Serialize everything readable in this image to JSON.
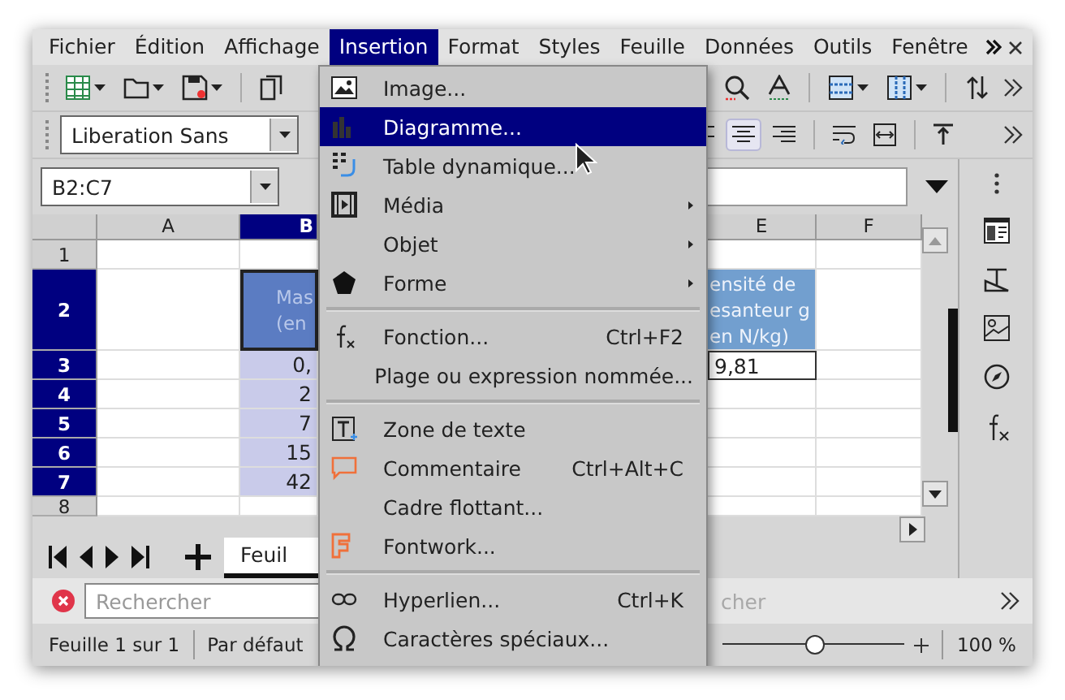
{
  "menubar": {
    "items": [
      {
        "label": "Fichier",
        "selected": false
      },
      {
        "label": "Édition",
        "selected": false
      },
      {
        "label": "Affichage",
        "selected": false
      },
      {
        "label": "Insertion",
        "selected": true
      },
      {
        "label": "Format",
        "selected": false
      },
      {
        "label": "Styles",
        "selected": false
      },
      {
        "label": "Feuille",
        "selected": false
      },
      {
        "label": "Données",
        "selected": false
      },
      {
        "label": "Outils",
        "selected": false
      },
      {
        "label": "Fenêtre",
        "selected": false
      }
    ]
  },
  "font_toolbar": {
    "font_name": "Liberation Sans"
  },
  "formula_bar": {
    "name_box": "B2:C7"
  },
  "grid": {
    "columns": [
      {
        "label": "A",
        "selected": false
      },
      {
        "label": "B",
        "selected": true
      },
      {
        "label": "E",
        "selected": false
      },
      {
        "label": "F",
        "selected": false
      }
    ],
    "rows": [
      {
        "header": "1",
        "selected": false,
        "kind": "data"
      },
      {
        "header": "2",
        "selected": true,
        "kind": "heading",
        "column_b": "Mas\n(en",
        "column_e": "ensité de\nesanteur g\nen N/kg)"
      },
      {
        "header": "3",
        "selected": true,
        "kind": "data",
        "column_b": "0,",
        "column_e": "9,81"
      },
      {
        "header": "4",
        "selected": true,
        "kind": "data",
        "column_b": "2"
      },
      {
        "header": "5",
        "selected": true,
        "kind": "data",
        "column_b": "7"
      },
      {
        "header": "6",
        "selected": true,
        "kind": "data",
        "column_b": "15"
      },
      {
        "header": "7",
        "selected": true,
        "kind": "data",
        "column_b": "42"
      },
      {
        "header": "8",
        "selected": false,
        "kind": "data"
      }
    ]
  },
  "sheet_tabs": [
    {
      "label": "Feuil",
      "selected": true
    }
  ],
  "find_bar": {
    "placeholder": "Rechercher",
    "search_button": {
      "label": "cher",
      "disabled": true
    }
  },
  "status_bar": {
    "sheet_info": "Feuille 1 sur 1",
    "page_style": "Par défaut",
    "zoom": {
      "level": 0.5,
      "reading": "100 %"
    }
  },
  "insert_menu": {
    "items": [
      {
        "kind": "image",
        "label": "Image...",
        "selected": false
      },
      {
        "kind": "chart",
        "label": "Diagramme...",
        "selected": true
      },
      {
        "kind": "pivot",
        "label": "Table dynamique...",
        "selected": false
      },
      {
        "kind": "media",
        "label": "Média",
        "selected": false,
        "submenu": true
      },
      {
        "kind": "object",
        "label": "Objet",
        "selected": false,
        "submenu": true
      },
      {
        "kind": "shape",
        "label": "Forme",
        "selected": false,
        "submenu": true
      },
      {
        "kind": "separator"
      },
      {
        "kind": "function",
        "label": "Fonction...",
        "shortcut": "Ctrl+F2",
        "selected": false
      },
      {
        "kind": "named-range",
        "label": "Plage ou expression nommée...",
        "selected": false
      },
      {
        "kind": "separator"
      },
      {
        "kind": "text-box",
        "label": "Zone de texte",
        "selected": false
      },
      {
        "kind": "comment",
        "label": "Commentaire",
        "shortcut": "Ctrl+Alt+C",
        "selected": false
      },
      {
        "kind": "frame",
        "label": "Cadre flottant...",
        "selected": false
      },
      {
        "kind": "fontwork",
        "label": "Fontwork...",
        "selected": false
      },
      {
        "kind": "separator"
      },
      {
        "kind": "hyperlink",
        "label": "Hyperlien...",
        "shortcut": "Ctrl+K",
        "selected": false
      },
      {
        "kind": "special-char",
        "label": "Caractères spéciaux...",
        "selected": false
      }
    ]
  }
}
